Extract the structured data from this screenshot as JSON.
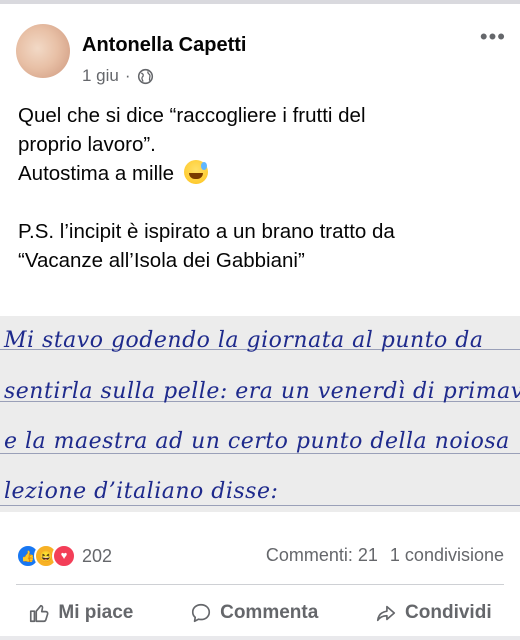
{
  "post": {
    "author": "Antonella Capetti",
    "time": "1 giu",
    "separator": "·",
    "more": "•••",
    "text": {
      "line1": "Quel che si dice “raccogliere i frutti del",
      "line2": "proprio lavoro”.",
      "line3": "Autostima a mille",
      "line4": "P.S. l’incipit è ispirato a un brano tratto da",
      "line5": "“Vacanze all’Isola dei Gabbiani”"
    },
    "handwriting": [
      "Mi stavo godendo la giornata al punto da",
      "sentirla sulla pelle: era un venerdì di primavera",
      "e la maestra ad un certo punto della noiosa",
      "lezione d’italiano disse:"
    ]
  },
  "stats": {
    "reactions_count": "202",
    "comments": "Commenti: 21",
    "shares": "1 condivisione"
  },
  "actions": {
    "like": "Mi piace",
    "comment": "Commenta",
    "share": "Condividi"
  },
  "colors": {
    "like": "#1877f2",
    "haha": "#f7b125",
    "love": "#f33e58",
    "ink": "#1e2a8c"
  }
}
